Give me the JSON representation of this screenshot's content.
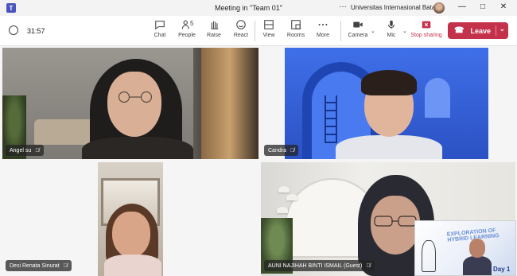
{
  "window": {
    "title": "Meeting in \"Team 01\"",
    "org": "Universitas Internasional Batam",
    "more_dots": "···",
    "minimize_label": "—",
    "maximize_label": "□",
    "close_label": "✕"
  },
  "toolbar": {
    "timer": "31:57",
    "buttons": {
      "chat": "Chat",
      "people": "People",
      "people_count": "5",
      "raise": "Raise",
      "react": "React",
      "view": "View",
      "rooms": "Rooms",
      "more": "More",
      "camera": "Camera",
      "mic": "Mic",
      "stop_sharing": "Stop sharing"
    },
    "leave_label": "Leave",
    "accent_color": "#c4314b"
  },
  "participants": [
    {
      "name": "Angel su"
    },
    {
      "name": "Candra"
    },
    {
      "name": "Desi Renata Sinurat"
    },
    {
      "name": "AUNI NAJIHAH BINTI ISMAIL (Guest)"
    }
  ],
  "shared_screen": {
    "slide_title": "EXPLORATION OF HYBRID LEARNING",
    "day_label": "Day 1"
  }
}
